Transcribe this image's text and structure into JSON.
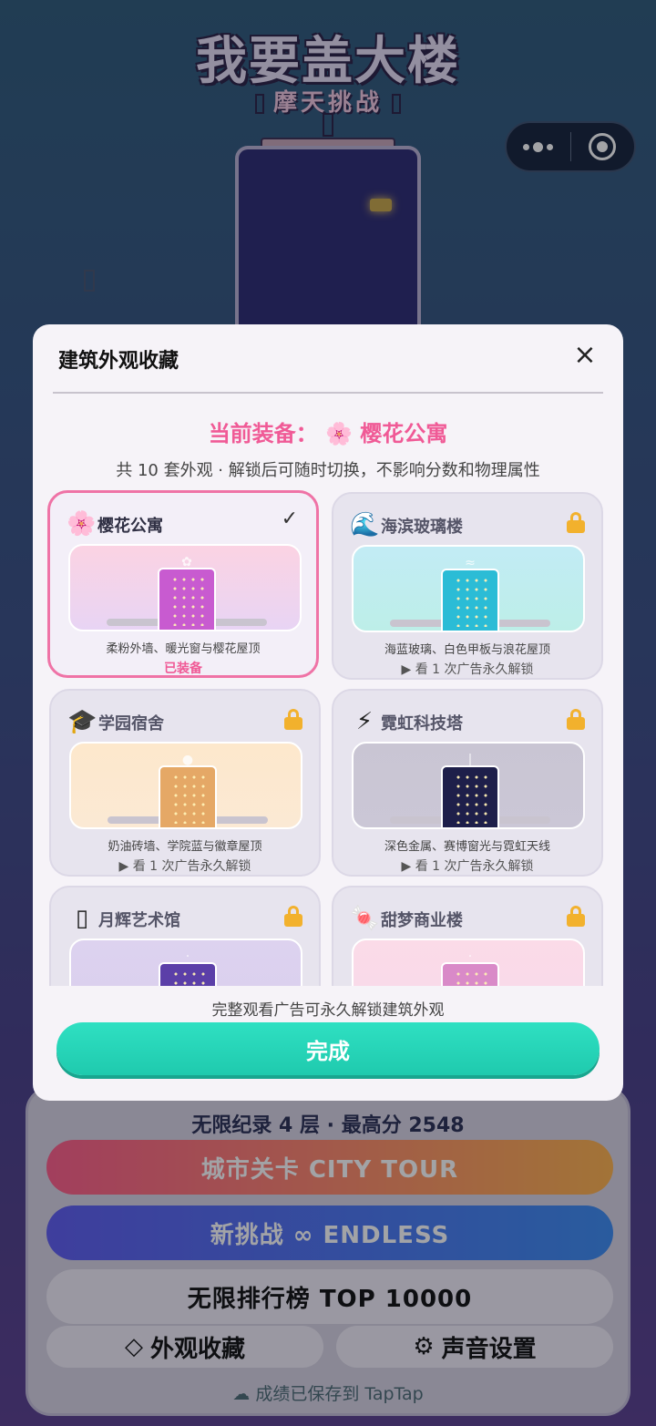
{
  "game": {
    "title": "我要盖大楼",
    "subtitle": "摩天挑战"
  },
  "menu": {
    "stats": "无限纪录 4 层 · 最高分 2548",
    "city_tour": "城市关卡 CITY TOUR",
    "endless": "新挑战 ∞ ENDLESS",
    "leaderboard": "无限排行榜 TOP 10000",
    "appearance": "外观收藏",
    "appearance_icon": "◇",
    "sound": "声音设置",
    "sound_icon": "⚙",
    "saved": "成绩已保存到 TapTap",
    "saved_icon": "☁"
  },
  "modal": {
    "title": "建筑外观收藏",
    "close_icon": "×",
    "equipped_prefix": "当前装备：",
    "equipped_icon": "🌸",
    "equipped_name": "樱花公寓",
    "summary": "共 10 套外观 · 解锁后可随时切换，不影响分数和物理属性",
    "footnote": "完整观看广告可永久解锁建筑外观",
    "done_label": "完成",
    "cards": [
      {
        "name": "樱花公寓",
        "icon": "🌸",
        "description": "柔粉外墙、暖光窗与樱花屋顶",
        "status": "已装备",
        "equipped": true,
        "colors": {
          "sky_top": "#fbd3e3",
          "sky_bottom": "#e8d4f4",
          "building": "#c85bd0",
          "roof": "✿"
        }
      },
      {
        "name": "海滨玻璃楼",
        "icon": "🌊",
        "description": "海蓝玻璃、白色甲板与浪花屋顶",
        "status": "▶ 看 1 次广告永久解锁",
        "equipped": false,
        "colors": {
          "sky_top": "#c2ecf5",
          "sky_bottom": "#bdeee8",
          "building": "#2bbcd6",
          "roof": "≈"
        }
      },
      {
        "name": "学园宿舍",
        "icon": "🎓",
        "description": "奶油砖墙、学院蓝与徽章屋顶",
        "status": "▶ 看 1 次广告永久解锁",
        "equipped": false,
        "colors": {
          "sky_top": "#fde8cc",
          "sky_bottom": "#fbe9d4",
          "building": "#e5a866",
          "roof": "●"
        }
      },
      {
        "name": "霓虹科技塔",
        "icon": "⚡",
        "description": "深色金属、赛博窗光与霓虹天线",
        "status": "▶ 看 1 次广告永久解锁",
        "equipped": false,
        "colors": {
          "sky_top": "#c9c5d3",
          "sky_bottom": "#cbc7d6",
          "building": "#1e1f4a",
          "roof": "|"
        }
      },
      {
        "name": "月辉艺术馆",
        "icon": "▯",
        "description": "",
        "status": "",
        "equipped": false,
        "colors": {
          "sky_top": "#ddd2ef",
          "sky_bottom": "#d9cfee",
          "building": "#5b3fa8",
          "roof": "·"
        }
      },
      {
        "name": "甜梦商业楼",
        "icon": "🍬",
        "description": "",
        "status": "",
        "equipped": false,
        "colors": {
          "sky_top": "#fbdbe8",
          "sky_bottom": "#f7d9ea",
          "building": "#d98ac8",
          "roof": "·"
        }
      }
    ]
  }
}
